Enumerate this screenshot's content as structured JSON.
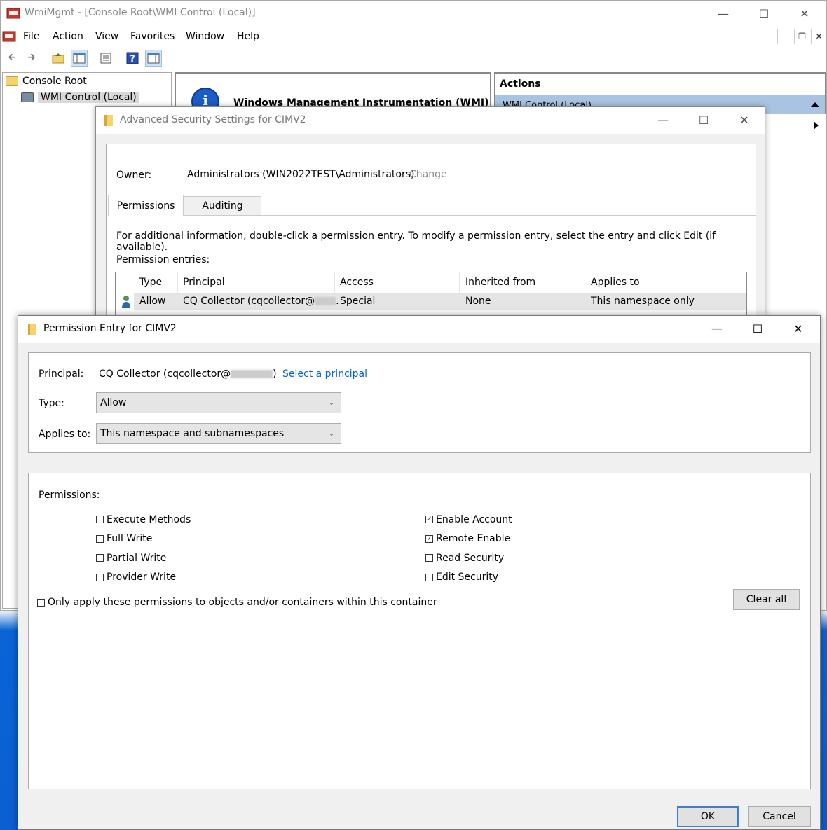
{
  "mmc": {
    "title": "WmiMgmt - [Console Root\\WMI Control (Local)]",
    "menu": [
      "File",
      "Action",
      "View",
      "Favorites",
      "Window",
      "Help"
    ],
    "tree": {
      "root": "Console Root",
      "child": "WMI Control (Local)"
    },
    "center_heading": "Windows Management Instrumentation (WMI)",
    "actions_heading": "Actions",
    "actions_item": "WMI Control (Local)"
  },
  "advanced": {
    "title": "Advanced Security Settings for CIMV2",
    "owner_label": "Owner:",
    "owner_value": "Administrators (WIN2022TEST\\Administrators)",
    "change_link": "Change",
    "tabs": [
      "Permissions",
      "Auditing"
    ],
    "info_text": "For additional information, double-click a permission entry. To modify a permission entry, select the entry and click Edit (if available).",
    "entries_label": "Permission entries:",
    "columns": [
      "Type",
      "Principal",
      "Access",
      "Inherited from",
      "Applies to"
    ],
    "rows": [
      {
        "type": "Allow",
        "principal": "CQ Collector (cqcollector@",
        "principal_tail": ".",
        "access": "Special",
        "inherited": "None",
        "applies": "This namespace only"
      }
    ]
  },
  "entry": {
    "title": "Permission Entry for CIMV2",
    "principal_label": "Principal:",
    "principal_value": "CQ Collector (cqcollector@",
    "principal_close": ")",
    "select_principal": "Select a principal",
    "type_label": "Type:",
    "type_value": "Allow",
    "applies_label": "Applies to:",
    "applies_value": "This namespace and subnamespaces",
    "permissions_label": "Permissions:",
    "left_perms": [
      {
        "label": "Execute Methods",
        "checked": false
      },
      {
        "label": "Full Write",
        "checked": false
      },
      {
        "label": "Partial Write",
        "checked": false
      },
      {
        "label": "Provider Write",
        "checked": false
      }
    ],
    "right_perms": [
      {
        "label": "Enable Account",
        "checked": true
      },
      {
        "label": "Remote Enable",
        "checked": true
      },
      {
        "label": "Read Security",
        "checked": false
      },
      {
        "label": "Edit Security",
        "checked": false
      }
    ],
    "only_apply_label": "Only apply these permissions to objects and/or containers within this container",
    "clear_all": "Clear all",
    "ok": "OK",
    "cancel": "Cancel"
  }
}
